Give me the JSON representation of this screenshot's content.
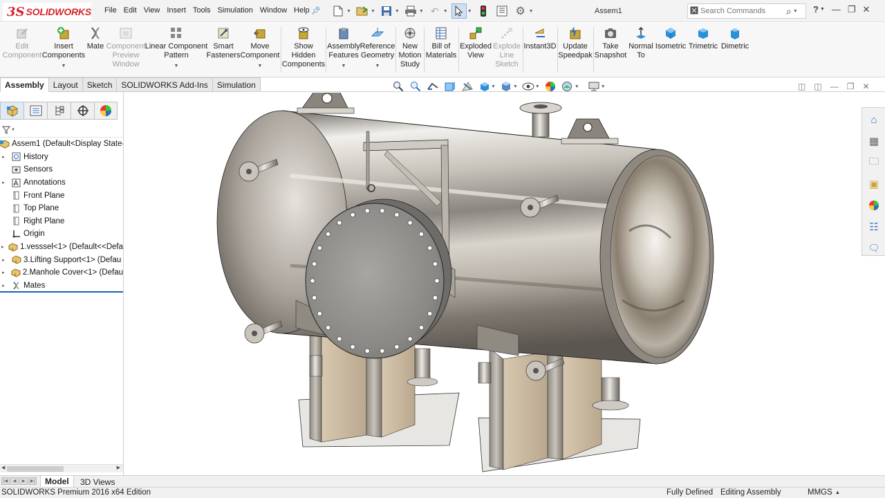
{
  "app": {
    "logo_prefix": "3S",
    "logo_text": "SOLIDWORKS",
    "doc_title": "Assem1"
  },
  "menu": [
    "File",
    "Edit",
    "View",
    "Insert",
    "Tools",
    "Simulation",
    "Window",
    "Help"
  ],
  "search": {
    "placeholder": "Search Commands"
  },
  "ribbon": {
    "commands": [
      {
        "label": "Edit\nComponent",
        "enabled": false,
        "icon": "edit-component-icon"
      },
      {
        "label": "Insert\nComponents",
        "enabled": true,
        "icon": "insert-components-icon",
        "dropdown": true
      },
      {
        "label": "Mate",
        "enabled": true,
        "icon": "mate-icon"
      },
      {
        "label": "Component\nPreview\nWindow",
        "enabled": false,
        "icon": "component-preview-icon"
      },
      {
        "label": "Linear Component\nPattern",
        "enabled": true,
        "icon": "linear-pattern-icon",
        "dropdown": true
      },
      {
        "label": "Smart\nFasteners",
        "enabled": true,
        "icon": "smart-fasteners-icon"
      },
      {
        "label": "Move\nComponent",
        "enabled": true,
        "icon": "move-component-icon",
        "dropdown": true
      },
      {
        "label": "Show\nHidden\nComponents",
        "enabled": true,
        "icon": "show-hidden-icon"
      },
      {
        "label": "Assembly\nFeatures",
        "enabled": true,
        "icon": "assembly-features-icon",
        "dropdown": true
      },
      {
        "label": "Reference\nGeometry",
        "enabled": true,
        "icon": "reference-geometry-icon",
        "dropdown": true
      },
      {
        "label": "New\nMotion\nStudy",
        "enabled": true,
        "icon": "motion-study-icon"
      },
      {
        "label": "Bill of\nMaterials",
        "enabled": true,
        "icon": "bom-icon"
      },
      {
        "label": "Exploded\nView",
        "enabled": true,
        "icon": "exploded-view-icon"
      },
      {
        "label": "Explode\nLine\nSketch",
        "enabled": false,
        "icon": "explode-line-icon"
      },
      {
        "label": "Instant3D",
        "enabled": true,
        "icon": "instant3d-icon"
      },
      {
        "label": "Update\nSpeedpak",
        "enabled": true,
        "icon": "speedpak-icon"
      },
      {
        "label": "Take\nSnapshot",
        "enabled": true,
        "icon": "snapshot-icon"
      },
      {
        "label": "Normal\nTo",
        "enabled": true,
        "icon": "normal-to-icon"
      },
      {
        "label": "Isometric",
        "enabled": true,
        "icon": "isometric-icon"
      },
      {
        "label": "Trimetric",
        "enabled": true,
        "icon": "trimetric-icon"
      },
      {
        "label": "Dimetric",
        "enabled": true,
        "icon": "dimetric-icon"
      }
    ]
  },
  "tabs": [
    {
      "label": "Assembly",
      "active": true
    },
    {
      "label": "Layout",
      "active": false
    },
    {
      "label": "Sketch",
      "active": false
    },
    {
      "label": "SOLIDWORKS Add-Ins",
      "active": false
    },
    {
      "label": "Simulation",
      "active": false
    }
  ],
  "tree": {
    "nodes": [
      {
        "label": "Assem1  (Default<Display State-",
        "expand": "",
        "icon": "assembly-icon",
        "indent": 0
      },
      {
        "label": "History",
        "expand": "▸",
        "icon": "history-icon",
        "indent": 1
      },
      {
        "label": "Sensors",
        "expand": "",
        "icon": "sensors-icon",
        "indent": 1
      },
      {
        "label": "Annotations",
        "expand": "▸",
        "icon": "annotations-icon",
        "indent": 1
      },
      {
        "label": "Front Plane",
        "expand": "",
        "icon": "plane-icon",
        "indent": 1
      },
      {
        "label": "Top Plane",
        "expand": "",
        "icon": "plane-icon",
        "indent": 1
      },
      {
        "label": "Right Plane",
        "expand": "",
        "icon": "plane-icon",
        "indent": 1
      },
      {
        "label": "Origin",
        "expand": "",
        "icon": "origin-icon",
        "indent": 1
      },
      {
        "label": "1.vesssel<1> (Default<<Defa",
        "expand": "▸",
        "icon": "part-icon",
        "indent": 1
      },
      {
        "label": "3.Lifting Support<1> (Defau",
        "expand": "▸",
        "icon": "part-icon",
        "indent": 1
      },
      {
        "label": "2.Manhole Cover<1> (Defau",
        "expand": "▸",
        "icon": "part-icon",
        "indent": 1
      },
      {
        "label": "Mates",
        "expand": "▸",
        "icon": "mates-icon",
        "indent": 1
      }
    ]
  },
  "bottom_tabs": [
    {
      "label": "Model",
      "active": true
    },
    {
      "label": "3D Views",
      "active": false
    }
  ],
  "status": {
    "edition": "SOLIDWORKS Premium 2016 x64 Edition",
    "defined": "Fully Defined",
    "mode": "Editing Assembly",
    "units": "MMGS"
  },
  "colors": {
    "brand": "#d8232a",
    "accent": "#1a5fb4",
    "steel": "#b8b4ae"
  }
}
